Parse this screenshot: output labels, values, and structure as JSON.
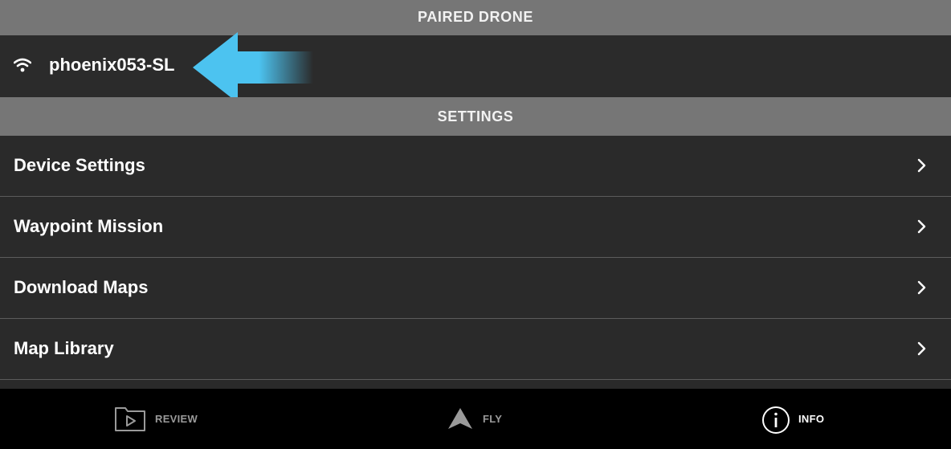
{
  "paired_section": {
    "header": "PAIRED DRONE",
    "drone_name": "phoenix053-SL",
    "connection_icon": "wifi-icon",
    "callout_icon": "left-arrow-callout-icon",
    "callout_color": "#4cc3f0"
  },
  "settings_section": {
    "header": "SETTINGS",
    "items": [
      {
        "label": "Device Settings"
      },
      {
        "label": "Waypoint Mission"
      },
      {
        "label": "Download Maps"
      },
      {
        "label": "Map Library"
      }
    ]
  },
  "tabbar": {
    "tabs": [
      {
        "label": "REVIEW",
        "icon": "review-play-folder-icon",
        "active": false
      },
      {
        "label": "FLY",
        "icon": "fly-arrow-icon",
        "active": false
      },
      {
        "label": "INFO",
        "icon": "info-circle-icon",
        "active": true
      }
    ]
  },
  "colors": {
    "header_bg": "#767676",
    "row_bg": "#2a2a2a",
    "tabbar_bg": "#000000",
    "active_tab": "#ffffff",
    "inactive_tab": "#9a9a9a"
  }
}
